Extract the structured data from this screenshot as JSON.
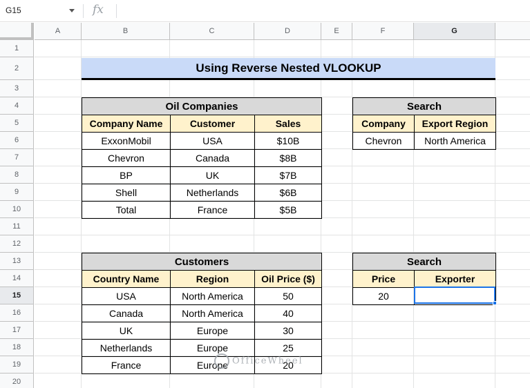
{
  "formula_bar": {
    "cell_ref": "G15",
    "fx_label": "fx",
    "formula": ""
  },
  "columns": [
    "A",
    "B",
    "C",
    "D",
    "E",
    "F",
    "G"
  ],
  "active_column": "G",
  "rows": [
    "1",
    "2",
    "3",
    "4",
    "5",
    "6",
    "7",
    "8",
    "9",
    "10",
    "11",
    "12",
    "13",
    "14",
    "15",
    "16",
    "17",
    "18",
    "19",
    "20"
  ],
  "active_row": "15",
  "title": "Using Reverse Nested VLOOKUP",
  "oil_companies": {
    "title": "Oil Companies",
    "headers": [
      "Company Name",
      "Customer",
      "Sales"
    ],
    "rows": [
      [
        "ExxonMobil",
        "USA",
        "$10B"
      ],
      [
        "Chevron",
        "Canada",
        "$8B"
      ],
      [
        "BP",
        "UK",
        "$7B"
      ],
      [
        "Shell",
        "Netherlands",
        "$6B"
      ],
      [
        "Total",
        "France",
        "$5B"
      ]
    ]
  },
  "search1": {
    "title": "Search",
    "headers": [
      "Company",
      "Export Region"
    ],
    "row": [
      "Chevron",
      "North America"
    ]
  },
  "customers": {
    "title": "Customers",
    "headers": [
      "Country Name",
      "Region",
      "Oil Price ($)"
    ],
    "rows": [
      [
        "USA",
        "North America",
        "50"
      ],
      [
        "Canada",
        "North America",
        "40"
      ],
      [
        "UK",
        "Europe",
        "30"
      ],
      [
        "Netherlands",
        "Europe",
        "25"
      ],
      [
        "France",
        "Europe",
        "20"
      ]
    ]
  },
  "search2": {
    "title": "Search",
    "headers": [
      "Price",
      "Exporter"
    ],
    "row": [
      "20",
      ""
    ]
  },
  "watermark": "OfficeWheel"
}
